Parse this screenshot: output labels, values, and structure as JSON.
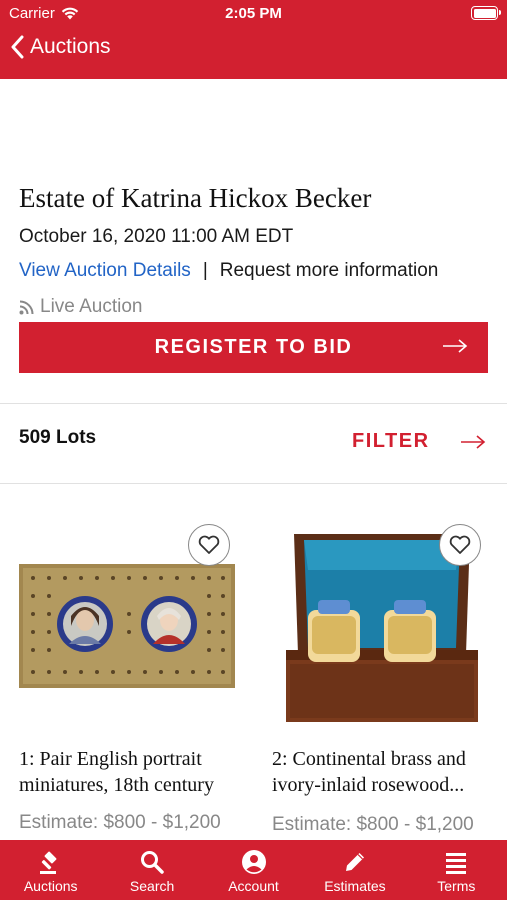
{
  "status_bar": {
    "carrier": "Carrier",
    "time": "2:05 PM"
  },
  "nav": {
    "back_label": "Auctions"
  },
  "auction": {
    "title": "Estate of Katrina Hickox Becker",
    "date": "October 16, 2020 11:00 AM EDT",
    "view_details": "View Auction Details",
    "separator": "|",
    "request_info": "Request more information",
    "live_label": "Live Auction",
    "register_label": "REGISTER TO BID"
  },
  "lots_bar": {
    "count": "509 Lots",
    "filter_label": "FILTER"
  },
  "lots": [
    {
      "title": "1: Pair English portrait miniatures, 18th century",
      "estimate": "Estimate: $800 - $1,200"
    },
    {
      "title": "2: Continental brass and ivory-inlaid rosewood...",
      "estimate": "Estimate: $800 - $1,200"
    }
  ],
  "tabs": [
    {
      "label": "Auctions",
      "icon": "gavel-icon"
    },
    {
      "label": "Search",
      "icon": "search-icon"
    },
    {
      "label": "Account",
      "icon": "account-icon"
    },
    {
      "label": "Estimates",
      "icon": "pencil-icon"
    },
    {
      "label": "Terms",
      "icon": "list-icon"
    }
  ],
  "colors": {
    "brand": "#d22030",
    "link": "#2264c6",
    "muted": "#888888"
  }
}
